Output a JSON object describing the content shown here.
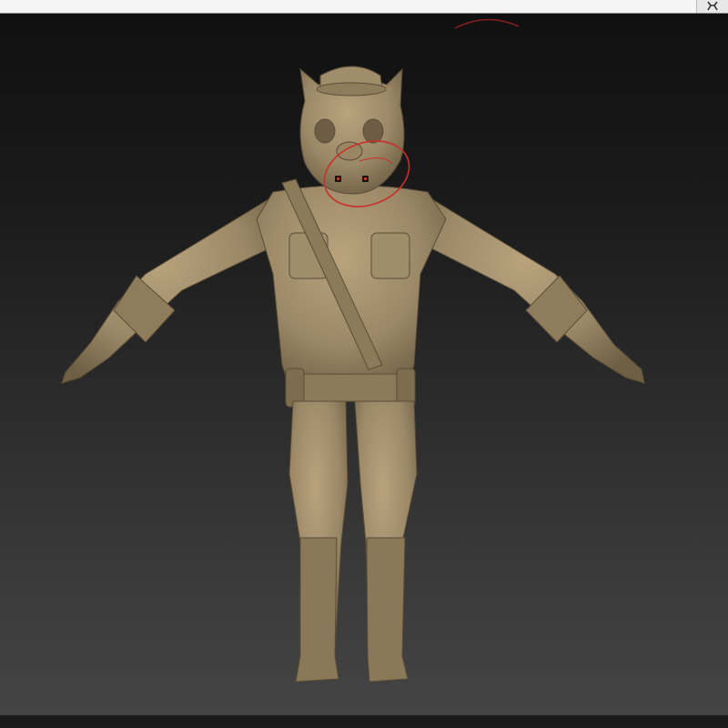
{
  "app": {
    "corner_icon": "transform-gizmo-icon"
  },
  "viewport": {
    "model": "cat-soldier-sculpt",
    "brush_cursor_color": "#c9302c",
    "clay_color": "#9b8866",
    "background_top": "#101010",
    "background_bottom": "#444444"
  }
}
